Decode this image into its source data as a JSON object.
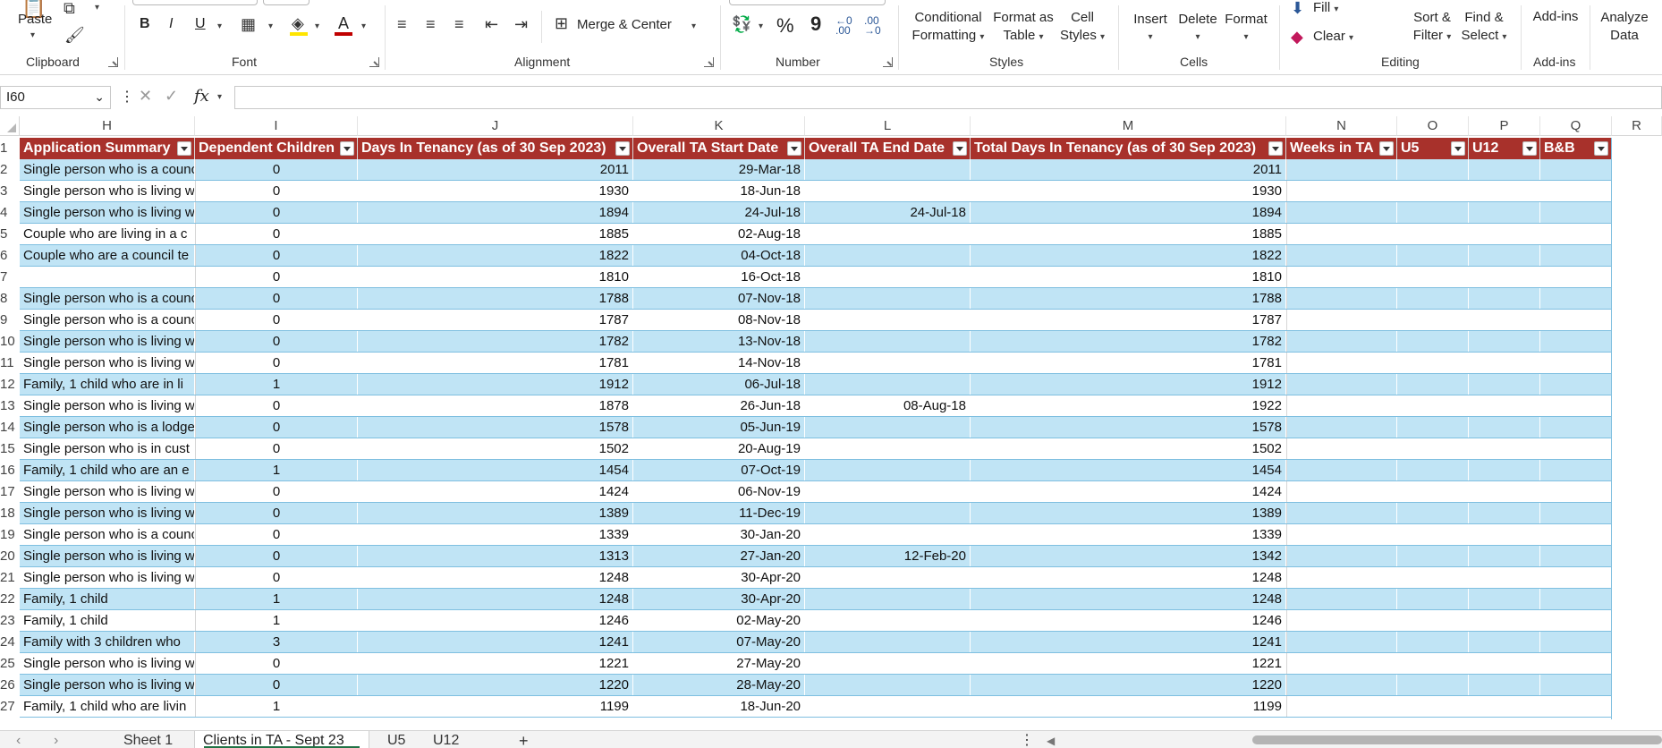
{
  "ribbon": {
    "clipboard": {
      "paste": "Paste",
      "label": "Clipboard"
    },
    "font": {
      "bold": "B",
      "italic": "I",
      "underline": "U",
      "font_color_letter": "A",
      "label": "Font"
    },
    "alignment": {
      "merge_center": "Merge & Center",
      "label": "Alignment"
    },
    "number": {
      "percent": "%",
      "comma": "9",
      "inc_decimal": "←0 .00",
      "dec_decimal": ".00 →0",
      "label": "Number"
    },
    "styles": {
      "conditional": [
        "Conditional",
        "Formatting"
      ],
      "format_table": [
        "Format as",
        "Table"
      ],
      "cell_styles": [
        "Cell",
        "Styles"
      ],
      "label": "Styles"
    },
    "cells": {
      "insert": "Insert",
      "delete": "Delete",
      "format": "Format",
      "label": "Cells"
    },
    "editing": {
      "fill": "Fill",
      "clear": "Clear",
      "sort_filter": [
        "Sort &",
        "Filter"
      ],
      "find_select": [
        "Find &",
        "Select"
      ],
      "label": "Editing"
    },
    "addins": {
      "addins": "Add-ins",
      "label": "Add-ins"
    },
    "analyze": {
      "analyze": [
        "Analyze",
        "Data"
      ]
    }
  },
  "formula_bar": {
    "name_box": "I60",
    "fx": "fx",
    "value": ""
  },
  "columns": {
    "letters": [
      "H",
      "I",
      "J",
      "K",
      "L",
      "M",
      "N",
      "O",
      "P",
      "Q",
      "R"
    ]
  },
  "table": {
    "headers": [
      "Application Summary",
      "Dependent Children",
      "Days In Tenancy (as of 30 Sep 2023)",
      "Overall TA Start Date",
      "Overall TA End Date",
      "Total Days In Tenancy (as of 30 Sep 2023)",
      "Weeks in TA",
      "U5",
      "U12",
      "B&B"
    ],
    "rows": [
      {
        "n": "2",
        "h": "Single person who is a counc",
        "i": "0",
        "j": "2011",
        "k": "29-Mar-18",
        "l": "",
        "m": "2011"
      },
      {
        "n": "3",
        "h": "Single person who is living w",
        "i": "0",
        "j": "1930",
        "k": "18-Jun-18",
        "l": "",
        "m": "1930"
      },
      {
        "n": "4",
        "h": "Single person who is living w",
        "i": "0",
        "j": "1894",
        "k": "24-Jul-18",
        "l": "24-Jul-18",
        "m": "1894"
      },
      {
        "n": "5",
        "h": "Couple who are living in a c",
        "i": "0",
        "j": "1885",
        "k": "02-Aug-18",
        "l": "",
        "m": "1885"
      },
      {
        "n": "6",
        "h": "Couple who are a council te",
        "i": "0",
        "j": "1822",
        "k": "04-Oct-18",
        "l": "",
        "m": "1822"
      },
      {
        "n": "7",
        "h": "",
        "i": "0",
        "j": "1810",
        "k": "16-Oct-18",
        "l": "",
        "m": "1810"
      },
      {
        "n": "8",
        "h": "Single person who is a counc",
        "i": "0",
        "j": "1788",
        "k": "07-Nov-18",
        "l": "",
        "m": "1788"
      },
      {
        "n": "9",
        "h": "Single person who is a counc",
        "i": "0",
        "j": "1787",
        "k": "08-Nov-18",
        "l": "",
        "m": "1787"
      },
      {
        "n": "10",
        "h": "Single person who is living w",
        "i": "0",
        "j": "1782",
        "k": "13-Nov-18",
        "l": "",
        "m": "1782"
      },
      {
        "n": "11",
        "h": "Single person who is living w",
        "i": "0",
        "j": "1781",
        "k": "14-Nov-18",
        "l": "",
        "m": "1781"
      },
      {
        "n": "12",
        "h": "Family, 1 child who are in li",
        "i": "1",
        "j": "1912",
        "k": "06-Jul-18",
        "l": "",
        "m": "1912"
      },
      {
        "n": "13",
        "h": "Single person who is living w",
        "i": "0",
        "j": "1878",
        "k": "26-Jun-18",
        "l": "08-Aug-18",
        "m": "1922"
      },
      {
        "n": "14",
        "h": "Single person who is a lodge",
        "i": "0",
        "j": "1578",
        "k": "05-Jun-19",
        "l": "",
        "m": "1578"
      },
      {
        "n": "15",
        "h": "Single person who is in cust",
        "i": "0",
        "j": "1502",
        "k": "20-Aug-19",
        "l": "",
        "m": "1502"
      },
      {
        "n": "16",
        "h": "Family, 1 child who are an e",
        "i": "1",
        "j": "1454",
        "k": "07-Oct-19",
        "l": "",
        "m": "1454"
      },
      {
        "n": "17",
        "h": "Single person who is living w",
        "i": "0",
        "j": "1424",
        "k": "06-Nov-19",
        "l": "",
        "m": "1424"
      },
      {
        "n": "18",
        "h": "Single person who is living w",
        "i": "0",
        "j": "1389",
        "k": "11-Dec-19",
        "l": "",
        "m": "1389"
      },
      {
        "n": "19",
        "h": "Single person who is a counc",
        "i": "0",
        "j": "1339",
        "k": "30-Jan-20",
        "l": "",
        "m": "1339"
      },
      {
        "n": "20",
        "h": "Single person who is living w",
        "i": "0",
        "j": "1313",
        "k": "27-Jan-20",
        "l": "12-Feb-20",
        "m": "1342"
      },
      {
        "n": "21",
        "h": "Single person who is living w",
        "i": "0",
        "j": "1248",
        "k": "30-Apr-20",
        "l": "",
        "m": "1248"
      },
      {
        "n": "22",
        "h": "Family, 1 child",
        "i": "1",
        "j": "1248",
        "k": "30-Apr-20",
        "l": "",
        "m": "1248"
      },
      {
        "n": "23",
        "h": "Family, 1 child",
        "i": "1",
        "j": "1246",
        "k": "02-May-20",
        "l": "",
        "m": "1246"
      },
      {
        "n": "24",
        "h": "Family with 3 children who",
        "i": "3",
        "j": "1241",
        "k": "07-May-20",
        "l": "",
        "m": "1241"
      },
      {
        "n": "25",
        "h": "Single person who is living w",
        "i": "0",
        "j": "1221",
        "k": "27-May-20",
        "l": "",
        "m": "1221"
      },
      {
        "n": "26",
        "h": "Single person who is living w",
        "i": "0",
        "j": "1220",
        "k": "28-May-20",
        "l": "",
        "m": "1220"
      },
      {
        "n": "27",
        "h": "Family, 1 child who are livin",
        "i": "1",
        "j": "1199",
        "k": "18-Jun-20",
        "l": "",
        "m": "1199"
      }
    ]
  },
  "sheet_tabs": {
    "tabs": [
      "Sheet 1",
      "Clients in TA - Sept 23",
      "U5",
      "U12"
    ],
    "active": "Clients in TA - Sept 23",
    "add": "+"
  },
  "colors": {
    "header_bg": "#a8312b",
    "band_blue": "#c0e4f5",
    "accent_green": "#217346"
  }
}
